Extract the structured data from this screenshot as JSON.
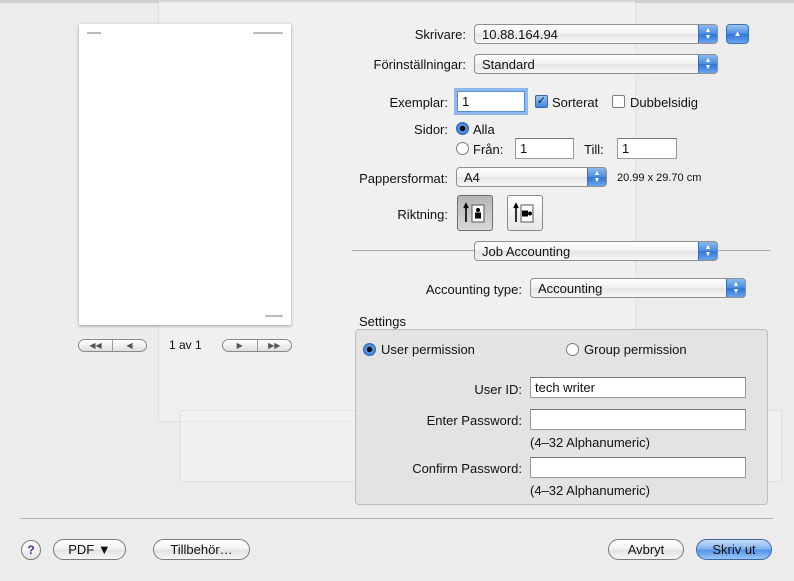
{
  "printer": {
    "label": "Skrivare:",
    "value": "10.88.164.94"
  },
  "presets": {
    "label": "Förinställningar:",
    "value": "Standard"
  },
  "copies": {
    "label": "Exemplar:",
    "value": "1",
    "collated_label": "Sorterat",
    "collated": true,
    "duplex_label": "Dubbelsidig",
    "duplex": false
  },
  "pages": {
    "label": "Sidor:",
    "all_label": "Alla",
    "from_label": "Från:",
    "from_value": "1",
    "to_label": "Till:",
    "to_value": "1"
  },
  "paper": {
    "label": "Pappersformat:",
    "value": "A4",
    "size_text": "20.99 x 29.70 cm"
  },
  "orientation": {
    "label": "Riktning:",
    "selected": "portrait"
  },
  "panel_menu": {
    "value": "Job Accounting"
  },
  "accounting": {
    "type_label": "Accounting type:",
    "type_value": "Accounting"
  },
  "settings": {
    "title": "Settings",
    "user_permission_label": "User permission",
    "group_permission_label": "Group permission",
    "user_id_label": "User ID:",
    "user_id_value": "tech writer",
    "enter_password_label": "Enter Password:",
    "enter_password_hint": "(4–32 Alphanumeric)",
    "confirm_password_label": "Confirm Password:",
    "confirm_password_hint": "(4–32 Alphanumeric)"
  },
  "preview": {
    "page_indicator": "1 av 1"
  },
  "footer": {
    "help": "?",
    "pdf": "PDF ▼",
    "accessories": "Tillbehör…",
    "cancel": "Avbryt",
    "print": "Skriv ut"
  },
  "icons": {
    "help": "help-icon",
    "expand": "triangle-up-icon",
    "portrait": "portrait-orientation-icon",
    "landscape": "landscape-orientation-icon"
  },
  "colors": {
    "accent": "#4b8ce0",
    "background": "#ececec"
  }
}
